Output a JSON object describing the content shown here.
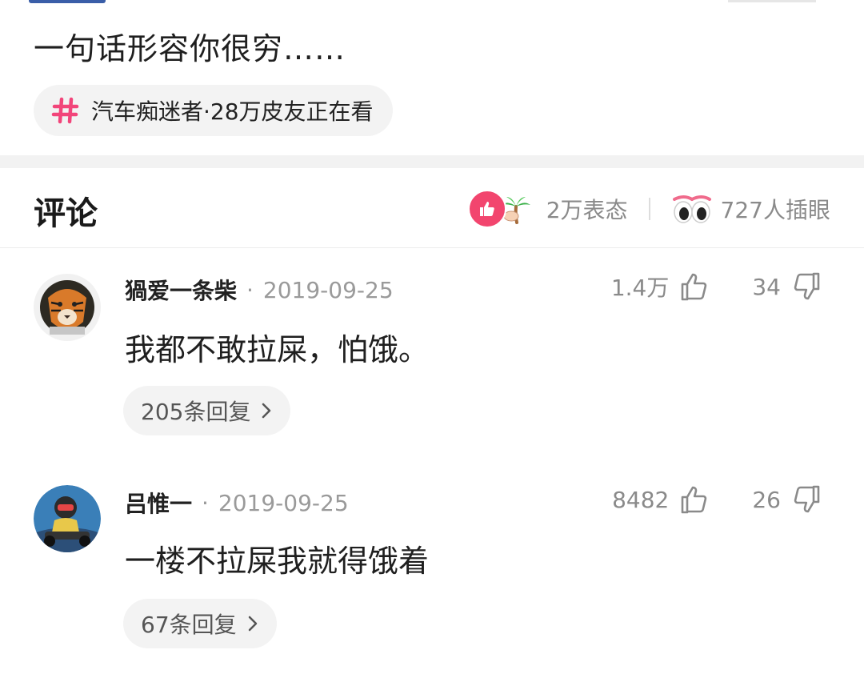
{
  "post": {
    "title": "一句话形容你很穷……",
    "topic": "汽车痴迷者·28万皮友正在看"
  },
  "comments_section": {
    "title": "评论",
    "reactions_count": "2万表态",
    "eyes_count": "727人插眼"
  },
  "comments": [
    {
      "username": "猧爱一条柴",
      "separator": "·",
      "date": "2019-09-25",
      "likes": "1.4万",
      "dislikes": "34",
      "text": "我都不敢拉屎，怕饿。",
      "replies": "205条回复"
    },
    {
      "username": "吕惟一",
      "separator": "·",
      "date": "2019-09-25",
      "likes": "8482",
      "dislikes": "26",
      "text": "一楼不拉屎我就得饿着",
      "replies": "67条回复"
    }
  ],
  "colors": {
    "accent_pink": "#f2456e",
    "muted_text": "#8a8a8a",
    "chip_bg": "#f3f3f3"
  },
  "icons": [
    "hashtag-icon",
    "like-reaction-icon",
    "palm-tree-icon",
    "eyes-icon",
    "thumbs-up-icon",
    "thumbs-down-icon",
    "chevron-right-icon"
  ]
}
